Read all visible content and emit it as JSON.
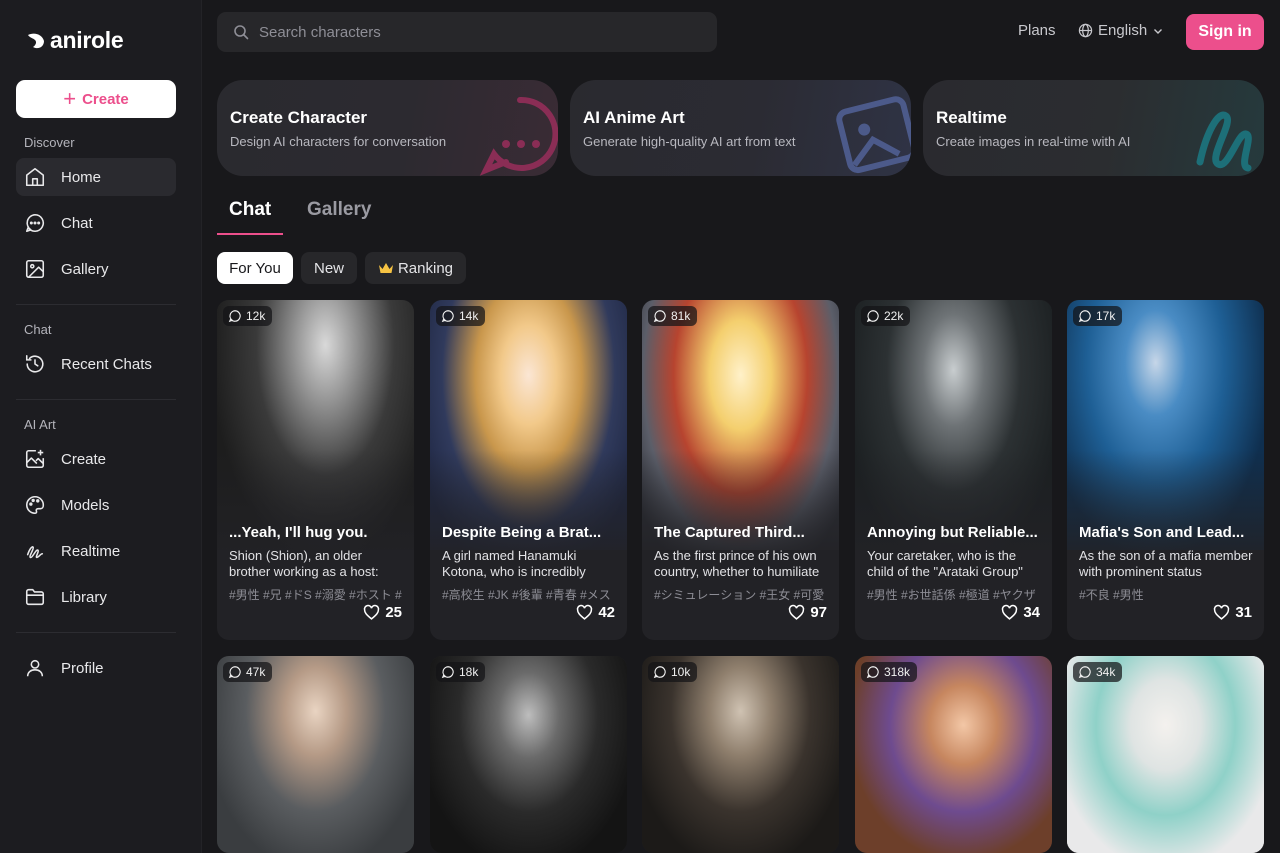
{
  "brand": {
    "name": "anirole"
  },
  "sidebar": {
    "create_label": "Create",
    "sections": [
      {
        "label": "Discover",
        "items": [
          {
            "label": "Home",
            "icon": "home-icon"
          },
          {
            "label": "Chat",
            "icon": "chat-icon"
          },
          {
            "label": "Gallery",
            "icon": "image-icon"
          }
        ]
      },
      {
        "label": "Chat",
        "items": [
          {
            "label": "Recent Chats",
            "icon": "history-icon"
          }
        ]
      },
      {
        "label": "AI Art",
        "items": [
          {
            "label": "Create",
            "icon": "image-edit-icon"
          },
          {
            "label": "Models",
            "icon": "palette-icon"
          },
          {
            "label": "Realtime",
            "icon": "scribble-icon"
          },
          {
            "label": "Library",
            "icon": "folder-icon"
          }
        ]
      }
    ],
    "profile_label": "Profile"
  },
  "topbar": {
    "search_placeholder": "Search characters",
    "plans": "Plans",
    "language": "English",
    "signin": "Sign in"
  },
  "features": [
    {
      "title": "Create Character",
      "subtitle": "Design AI characters for conversation"
    },
    {
      "title": "AI Anime Art",
      "subtitle": "Generate high-quality AI art from text"
    },
    {
      "title": "Realtime",
      "subtitle": "Create images in real-time with AI"
    }
  ],
  "tabs": [
    "Chat",
    "Gallery"
  ],
  "filters": [
    "For You",
    "New",
    "Ranking"
  ],
  "cards_row1": [
    {
      "count": "12k",
      "title": "...Yeah, I'll hug you.",
      "desc": "Shion (Shion), an older brother working as a host: \"...Yeah, I'll hug you.\"",
      "tags": "#男性 #兄 #ドS #溺愛 #ホスト #",
      "likes": "25"
    },
    {
      "count": "14k",
      "title": "Despite Being a Brat...",
      "desc": "A girl named Hanamuki Kotona, who is incredibly bratty",
      "tags": "#高校生 #JK #後輩 #青春 #メス",
      "likes": "42"
    },
    {
      "count": "81k",
      "title": "The Captured Third...",
      "desc": "As the first prince of his own country, whether to humiliate her",
      "tags": "#シミュレーション #王女 #可愛",
      "likes": "97"
    },
    {
      "count": "22k",
      "title": "Annoying but Reliable...",
      "desc": "Your caretaker, who is the child of the \"Arataki Group\" yakuza",
      "tags": "#男性 #お世話係 #極道 #ヤクザ",
      "likes": "34"
    },
    {
      "count": "17k",
      "title": "Mafia's Son and Lead...",
      "desc": "As the son of a mafia member with prominent status",
      "tags": "#不良 #男性",
      "likes": "31"
    }
  ],
  "cards_row2": [
    {
      "count": "47k"
    },
    {
      "count": "18k"
    },
    {
      "count": "10k"
    },
    {
      "count": "318k"
    },
    {
      "count": "34k"
    }
  ],
  "colors": {
    "accent": "#ec4f8c",
    "background": "#18181b",
    "sidebar": "#1c1c20"
  }
}
